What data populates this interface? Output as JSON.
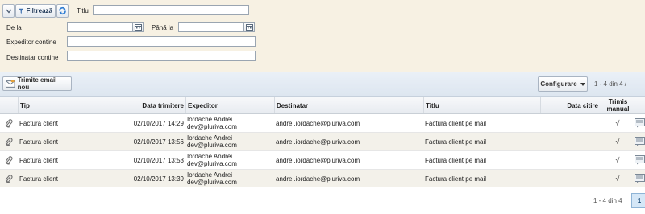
{
  "filter": {
    "filter_button": "Filtrează",
    "title_label": "Titlu",
    "title_value": "",
    "from_label": "De la",
    "from_value": "",
    "to_label": "Până la",
    "to_value": "",
    "sender_label": "Expeditor contine",
    "sender_value": "",
    "recipient_label": "Destinatar contine",
    "recipient_value": ""
  },
  "toolbar": {
    "send_email_label": "Trimite email nou",
    "configure_label": "Configurare",
    "pager_text": "1 - 4 din 4 /"
  },
  "table": {
    "headers": {
      "tip": "Tip",
      "data_trimitere": "Data trimitere",
      "expeditor": "Expeditor",
      "destinatar": "Destinatar",
      "titlu": "Titlu",
      "data_citire": "Data citire",
      "trimis_manual_line1": "Trimis",
      "trimis_manual_line2": "manual"
    },
    "rows": [
      {
        "tip": "Factura client",
        "data_trimitere": "02/10/2017 14:29",
        "expeditor_name": "Iordache Andrei",
        "expeditor_email": "dev@pluriva.com",
        "destinatar": "andrei.iordache@pluriva.com",
        "titlu": "Factura client pe mail",
        "data_citire": "",
        "trimis_manual": "√"
      },
      {
        "tip": "Factura client",
        "data_trimitere": "02/10/2017 13:56",
        "expeditor_name": "Iordache Andrei",
        "expeditor_email": "dev@pluriva.com",
        "destinatar": "andrei.iordache@pluriva.com",
        "titlu": "Factura client pe mail",
        "data_citire": "",
        "trimis_manual": "√"
      },
      {
        "tip": "Factura client",
        "data_trimitere": "02/10/2017 13:53",
        "expeditor_name": "Iordache Andrei",
        "expeditor_email": "dev@pluriva.com",
        "destinatar": "andrei.iordache@pluriva.com",
        "titlu": "Factura client pe mail",
        "data_citire": "",
        "trimis_manual": "√"
      },
      {
        "tip": "Factura client",
        "data_trimitere": "02/10/2017 13:39",
        "expeditor_name": "Iordache Andrei",
        "expeditor_email": "dev@pluriva.com",
        "destinatar": "andrei.iordache@pluriva.com",
        "titlu": "Factura client pe mail",
        "data_citire": "",
        "trimis_manual": "√"
      }
    ]
  },
  "footer": {
    "pager_text": "1 - 4 din 4",
    "current_page": "1"
  },
  "icons": {
    "attachment": "paperclip-icon",
    "view": "view-message-icon",
    "filter": "funnel-icon",
    "refresh": "refresh-icon",
    "calendar": "calendar-icon",
    "email": "email-icon"
  },
  "colors": {
    "filter_background": "#f7f1e3",
    "toolbar_background": "#e3eaf3",
    "alt_row": "#f3f1ea",
    "active_page": "#d5e7f7"
  }
}
